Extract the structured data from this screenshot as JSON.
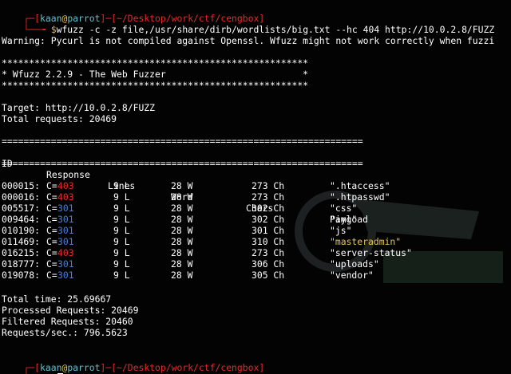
{
  "terminal": {
    "prompt1": {
      "open": "┌─[",
      "user": "kaan",
      "at": "@",
      "host": "parrot",
      "mid": "]─[",
      "path": "~/Desktop/work/ctf/cengbox",
      "close": "]",
      "line2_prefix": "└──╼ ",
      "dollar": "$",
      "command": "wfuzz -c -z file,/usr/share/dirb/wordlists/big.txt --hc 404 http://10.0.2.8/FUZZ"
    },
    "warning": "Warning: Pycurl is not compiled against Openssl. Wfuzz might not work correctly when fuzzi",
    "banner": {
      "stars": "********************************************************",
      "title": "* Wfuzz 2.2.9 - The Web Fuzzer                         *"
    },
    "target": "Target: http://10.0.2.8/FUZZ",
    "total_requests": "Total requests: 20469",
    "separator": "==================================================================",
    "headers": {
      "id": "ID",
      "response": "Response",
      "lines": "Lines",
      "word": "Word",
      "chars": "Chars",
      "payload": "Payload"
    },
    "rows": [
      {
        "id": "000015:",
        "c": "C=",
        "code": "403",
        "lines": "9 L",
        "word": "28 W",
        "chars": "273 Ch",
        "payload": "\".htaccess\""
      },
      {
        "id": "000016:",
        "c": "C=",
        "code": "403",
        "lines": "9 L",
        "word": "28 W",
        "chars": "273 Ch",
        "payload": "\".htpasswd\""
      },
      {
        "id": "005517:",
        "c": "C=",
        "code": "301",
        "lines": "9 L",
        "word": "28 W",
        "chars": "302 Ch",
        "payload": "\"css\""
      },
      {
        "id": "009464:",
        "c": "C=",
        "code": "301",
        "lines": "9 L",
        "word": "28 W",
        "chars": "302 Ch",
        "payload": "\"img\""
      },
      {
        "id": "010190:",
        "c": "C=",
        "code": "301",
        "lines": "9 L",
        "word": "28 W",
        "chars": "301 Ch",
        "payload": "\"js\""
      },
      {
        "id": "011469:",
        "c": "C=",
        "code": "301",
        "lines": "9 L",
        "word": "28 W",
        "chars": "310 Ch",
        "payload": "\"masteradmin\""
      },
      {
        "id": "016215:",
        "c": "C=",
        "code": "403",
        "lines": "9 L",
        "word": "28 W",
        "chars": "273 Ch",
        "payload": "\"server-status\""
      },
      {
        "id": "018777:",
        "c": "C=",
        "code": "301",
        "lines": "9 L",
        "word": "28 W",
        "chars": "306 Ch",
        "payload": "\"uploads\""
      },
      {
        "id": "019078:",
        "c": "C=",
        "code": "301",
        "lines": "9 L",
        "word": "28 W",
        "chars": "305 Ch",
        "payload": "\"vendor\""
      }
    ],
    "summary": {
      "total_time": "Total time: 25.69667",
      "processed": "Processed Requests: 20469",
      "filtered": "Filtered Requests: 20460",
      "rate": "Requests/sec.: 796.5623"
    },
    "prompt2": {
      "open": "┌─[",
      "user": "kaan",
      "at": "@",
      "host": "parrot",
      "mid": "]─[",
      "path": "~/Desktop/work/ctf/cengbox",
      "close": "]",
      "line2_prefix": "└──╼ ",
      "dollar": "$"
    },
    "colors": {
      "background": "#030303",
      "prompt_red": "#e82a2a",
      "prompt_cyan": "#5ec2ce",
      "code_403": "#e82a2a",
      "code_301": "#4a7fd1",
      "highlight_payload": "#e6c64a"
    }
  }
}
